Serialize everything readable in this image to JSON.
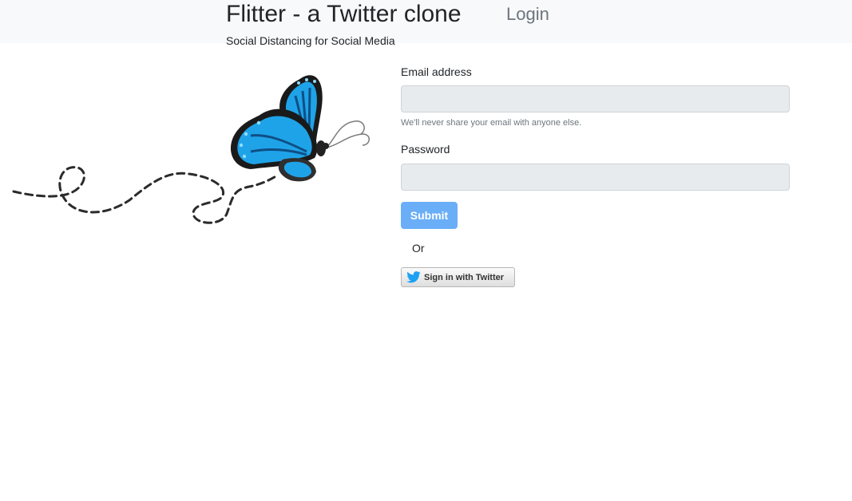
{
  "header": {
    "brand": "Flitter - a Twitter clone",
    "nav_login": "Login",
    "tagline": "Social Distancing for Social Media"
  },
  "form": {
    "email_label": "Email address",
    "email_value": "",
    "email_help": "We'll never share your email with anyone else.",
    "password_label": "Password",
    "password_value": "",
    "submit_label": "Submit",
    "or_text": "Or",
    "twitter_button_label": "Sign in with Twitter"
  },
  "illustration": {
    "icon": "butterfly-icon",
    "trail": "dashed-flight-path"
  },
  "colors": {
    "navbar_bg": "#f8f9fa",
    "submit_bg": "#6aaef8",
    "input_bg": "#e8ebee",
    "twitter_blue": "#1da1f2",
    "butterfly_blue": "#1fa3e8"
  }
}
